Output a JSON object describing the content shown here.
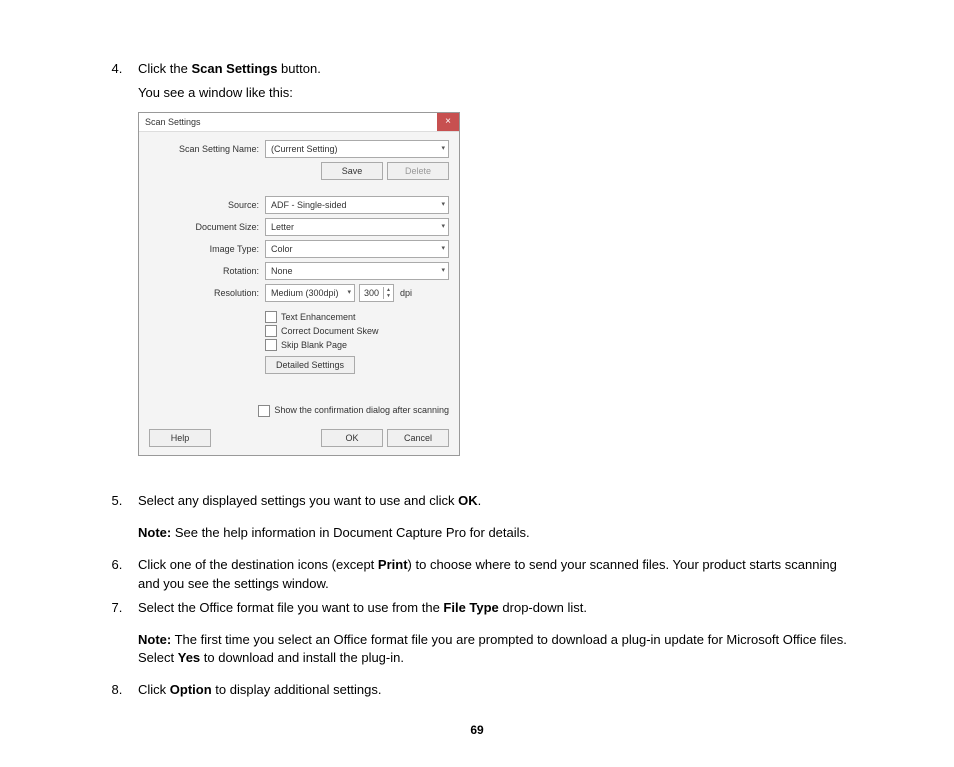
{
  "step4": {
    "pre": "Click the ",
    "bold": "Scan Settings",
    "post": " button.",
    "line2": "You see a window like this:"
  },
  "dialog": {
    "title": "Scan Settings",
    "close": "×",
    "name_label": "Scan Setting Name:",
    "name_value": "(Current Setting)",
    "save": "Save",
    "delete": "Delete",
    "source_label": "Source:",
    "source_value": "ADF - Single-sided",
    "docsize_label": "Document Size:",
    "docsize_value": "Letter",
    "imgtype_label": "Image Type:",
    "imgtype_value": "Color",
    "rotation_label": "Rotation:",
    "rotation_value": "None",
    "res_label": "Resolution:",
    "res_value": "Medium (300dpi)",
    "res_num": "300",
    "res_unit": "dpi",
    "chk_text": "Text Enhancement",
    "chk_skew": "Correct Document Skew",
    "chk_blank": "Skip Blank Page",
    "detailed": "Detailed Settings",
    "confirm": "Show the confirmation dialog after scanning",
    "help": "Help",
    "ok": "OK",
    "cancel": "Cancel"
  },
  "step5": {
    "pre": "Select any displayed settings you want to use and click ",
    "bold": "OK",
    "post": ".",
    "note_b": "Note:",
    "note": " See the help information in Document Capture Pro for details."
  },
  "step6": {
    "pre": "Click one of the destination icons (except ",
    "bold": "Print",
    "post": ") to choose where to send your scanned files. Your product starts scanning and you see the settings window."
  },
  "step7": {
    "pre": "Select the Office format file you want to use from the ",
    "bold": "File Type",
    "post": " drop-down list.",
    "note_b": "Note:",
    "note_pre": " The first time you select an Office format file you are prompted to download a plug-in update for Microsoft Office files. Select ",
    "note_bold": "Yes",
    "note_post": " to download and install the plug-in."
  },
  "step8": {
    "pre": "Click ",
    "bold": "Option",
    "post": " to display additional settings."
  },
  "page_num": "69"
}
